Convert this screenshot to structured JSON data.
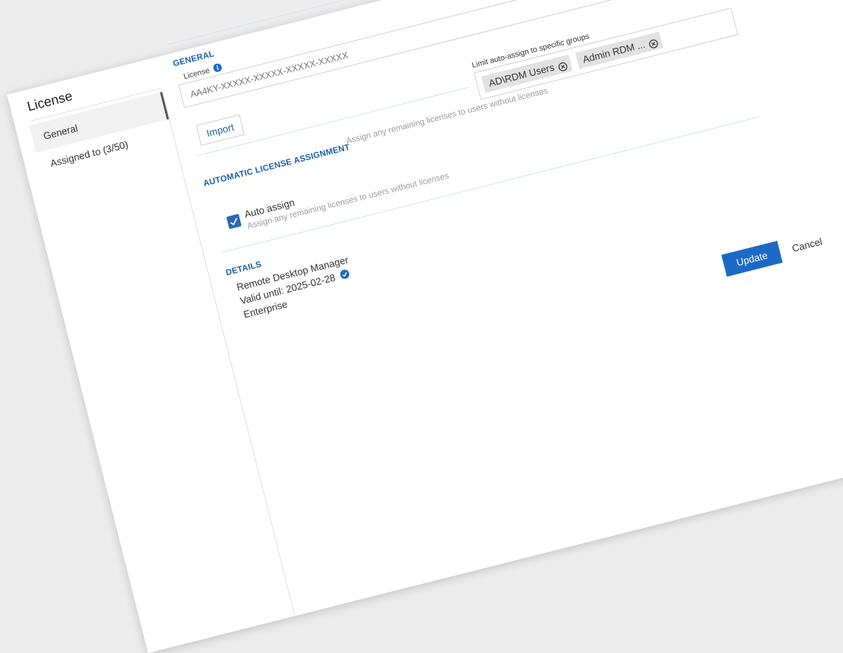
{
  "dialog": {
    "title": "License"
  },
  "sidebar": {
    "items": [
      {
        "label": "General",
        "active": true
      },
      {
        "label": "Assigned to (3/50)",
        "active": false
      }
    ]
  },
  "general": {
    "section_title": "GENERAL",
    "license_label": "License",
    "license_placeholder": "AA4KY-XXXXX-XXXXX-XXXXX-XXXXX",
    "import_label": "Import"
  },
  "auto_assignment": {
    "section_title": "AUTOMATIC LICENSE ASSIGNMENT",
    "limit_label": "Limit auto-assign to specific groups",
    "groups": [
      "AD\\RDM Users",
      "Admin RDM ..."
    ],
    "auto_assign_label": "Auto assign",
    "auto_assign_description": "Assign any remaining licenses to users without licenses",
    "auto_assign_checked": true,
    "description_right": "Assign any remaining licenses to users without licenses"
  },
  "details": {
    "section_title": "DETAILS",
    "product": "Remote Desktop Manager",
    "valid_until": "Valid until: 2025-02-28",
    "edition": "Enterprise"
  },
  "footer": {
    "update_label": "Update",
    "cancel_label": "Cancel"
  },
  "colors": {
    "accent": "#1d6ac6",
    "section_title": "#1b5faa"
  },
  "icons": [
    "eye-icon",
    "info-icon",
    "chevron-down-icon",
    "remove-chip-icon",
    "checkmark-icon",
    "verified-icon"
  ]
}
